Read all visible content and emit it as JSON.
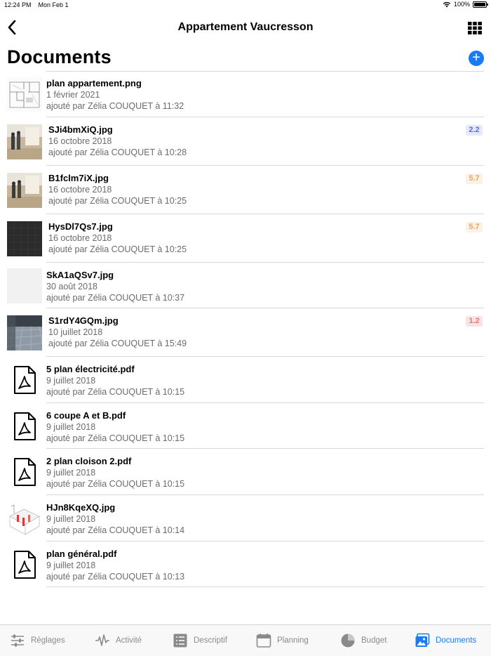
{
  "status_bar": {
    "time": "12:24 PM",
    "date": "Mon Feb 1",
    "battery": "100%"
  },
  "nav": {
    "title": "Appartement Vaucresson"
  },
  "header": {
    "title": "Documents",
    "add_label": "+"
  },
  "documents": [
    {
      "name": "plan appartement.png",
      "date": "1 février 2021",
      "author": "ajouté par Zélia COUQUET à 11:32",
      "thumb": "plan-sketch"
    },
    {
      "name": "SJi4bmXiQ.jpg",
      "date": "16 octobre 2018",
      "author": "ajouté par Zélia COUQUET à 10:28",
      "badge": "2.2",
      "badge_color": "#5a6ed6",
      "thumb": "room-photo"
    },
    {
      "name": "B1fclm7iX.jpg",
      "date": "16 octobre 2018",
      "author": "ajouté par Zélia COUQUET à 10:25",
      "badge": "5.7",
      "badge_color": "#e6a865",
      "thumb": "room-photo"
    },
    {
      "name": "HysDl7Qs7.jpg",
      "date": "16 octobre 2018",
      "author": "ajouté par Zélia COUQUET à 10:25",
      "badge": "5.7",
      "badge_color": "#e6a865",
      "thumb": "dark-photo"
    },
    {
      "name": "SkA1aQSv7.jpg",
      "date": "30 août 2018",
      "author": "ajouté par Zélia COUQUET à 10:37",
      "thumb": "blank"
    },
    {
      "name": "S1rdY4GQm.jpg",
      "date": "10 juillet 2018",
      "author": "ajouté par Zélia COUQUET à 15:49",
      "badge": "1.2",
      "badge_color": "#e17a7a",
      "thumb": "floor-photo"
    },
    {
      "name": "5 plan électricité.pdf",
      "date": "9 juillet 2018",
      "author": "ajouté par Zélia COUQUET à 10:15",
      "thumb": "pdf-icon"
    },
    {
      "name": "6 coupe A et B.pdf",
      "date": "9 juillet 2018",
      "author": "ajouté par Zélia COUQUET à 10:15",
      "thumb": "pdf-icon"
    },
    {
      "name": "2 plan cloison 2.pdf",
      "date": "9 juillet 2018",
      "author": "ajouté par Zélia COUQUET à 10:15",
      "thumb": "pdf-icon"
    },
    {
      "name": "HJn8KqeXQ.jpg",
      "date": "9 juillet 2018",
      "author": "ajouté par Zélia COUQUET à 10:14",
      "thumb": "3d-plan"
    },
    {
      "name": "plan général.pdf",
      "date": "9 juillet 2018",
      "author": "ajouté par Zélia COUQUET à 10:13",
      "thumb": "pdf-icon"
    }
  ],
  "tabs": [
    {
      "label": "Réglages",
      "icon": "sliders-icon"
    },
    {
      "label": "Activité",
      "icon": "activity-icon"
    },
    {
      "label": "Descriptif",
      "icon": "list-icon"
    },
    {
      "label": "Planning",
      "icon": "calendar-icon"
    },
    {
      "label": "Budget",
      "icon": "pie-chart-icon"
    },
    {
      "label": "Documents",
      "icon": "documents-icon",
      "active": true
    }
  ],
  "colors": {
    "accent": "#1a7cf5",
    "separator": "#d8d8d8",
    "secondary_text": "#6b6b6b"
  }
}
